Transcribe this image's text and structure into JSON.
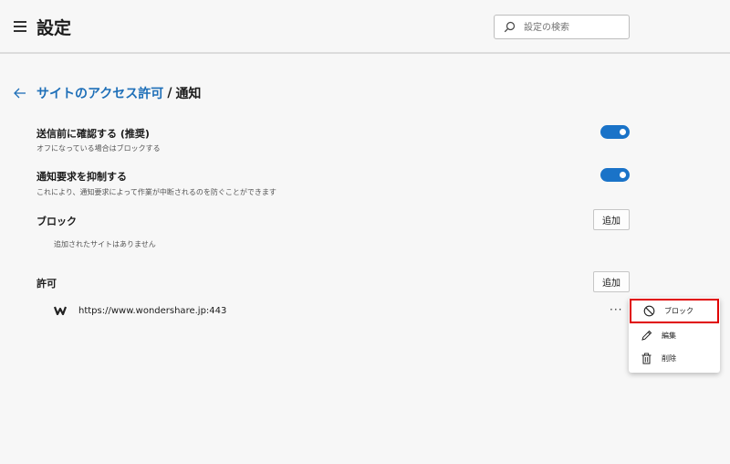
{
  "header": {
    "title": "設定",
    "search_placeholder": "設定の検索"
  },
  "breadcrumb": {
    "parent": "サイトのアクセス許可",
    "separator": "/",
    "current": "通知"
  },
  "settings": [
    {
      "title": "送信前に確認する (推奨)",
      "description": "オフになっている場合はブロックする",
      "enabled": true
    },
    {
      "title": "通知要求を抑制する",
      "description": "これにより、通知要求によって作業が中断されるのを防ぐことができます",
      "enabled": true
    }
  ],
  "block_section": {
    "title": "ブロック",
    "add_label": "追加",
    "empty_text": "追加されたサイトはありません"
  },
  "allow_section": {
    "title": "許可",
    "add_label": "追加",
    "sites": [
      {
        "url": "https://www.wondershare.jp:443",
        "more": "···"
      }
    ]
  },
  "context_menu": {
    "items": [
      {
        "label": "ブロック",
        "icon": "block-icon"
      },
      {
        "label": "編集",
        "icon": "edit-icon"
      },
      {
        "label": "削除",
        "icon": "delete-icon"
      }
    ]
  },
  "colors": {
    "accent": "#1a73c8",
    "link": "#1e6fb8",
    "highlight": "#e00000"
  }
}
